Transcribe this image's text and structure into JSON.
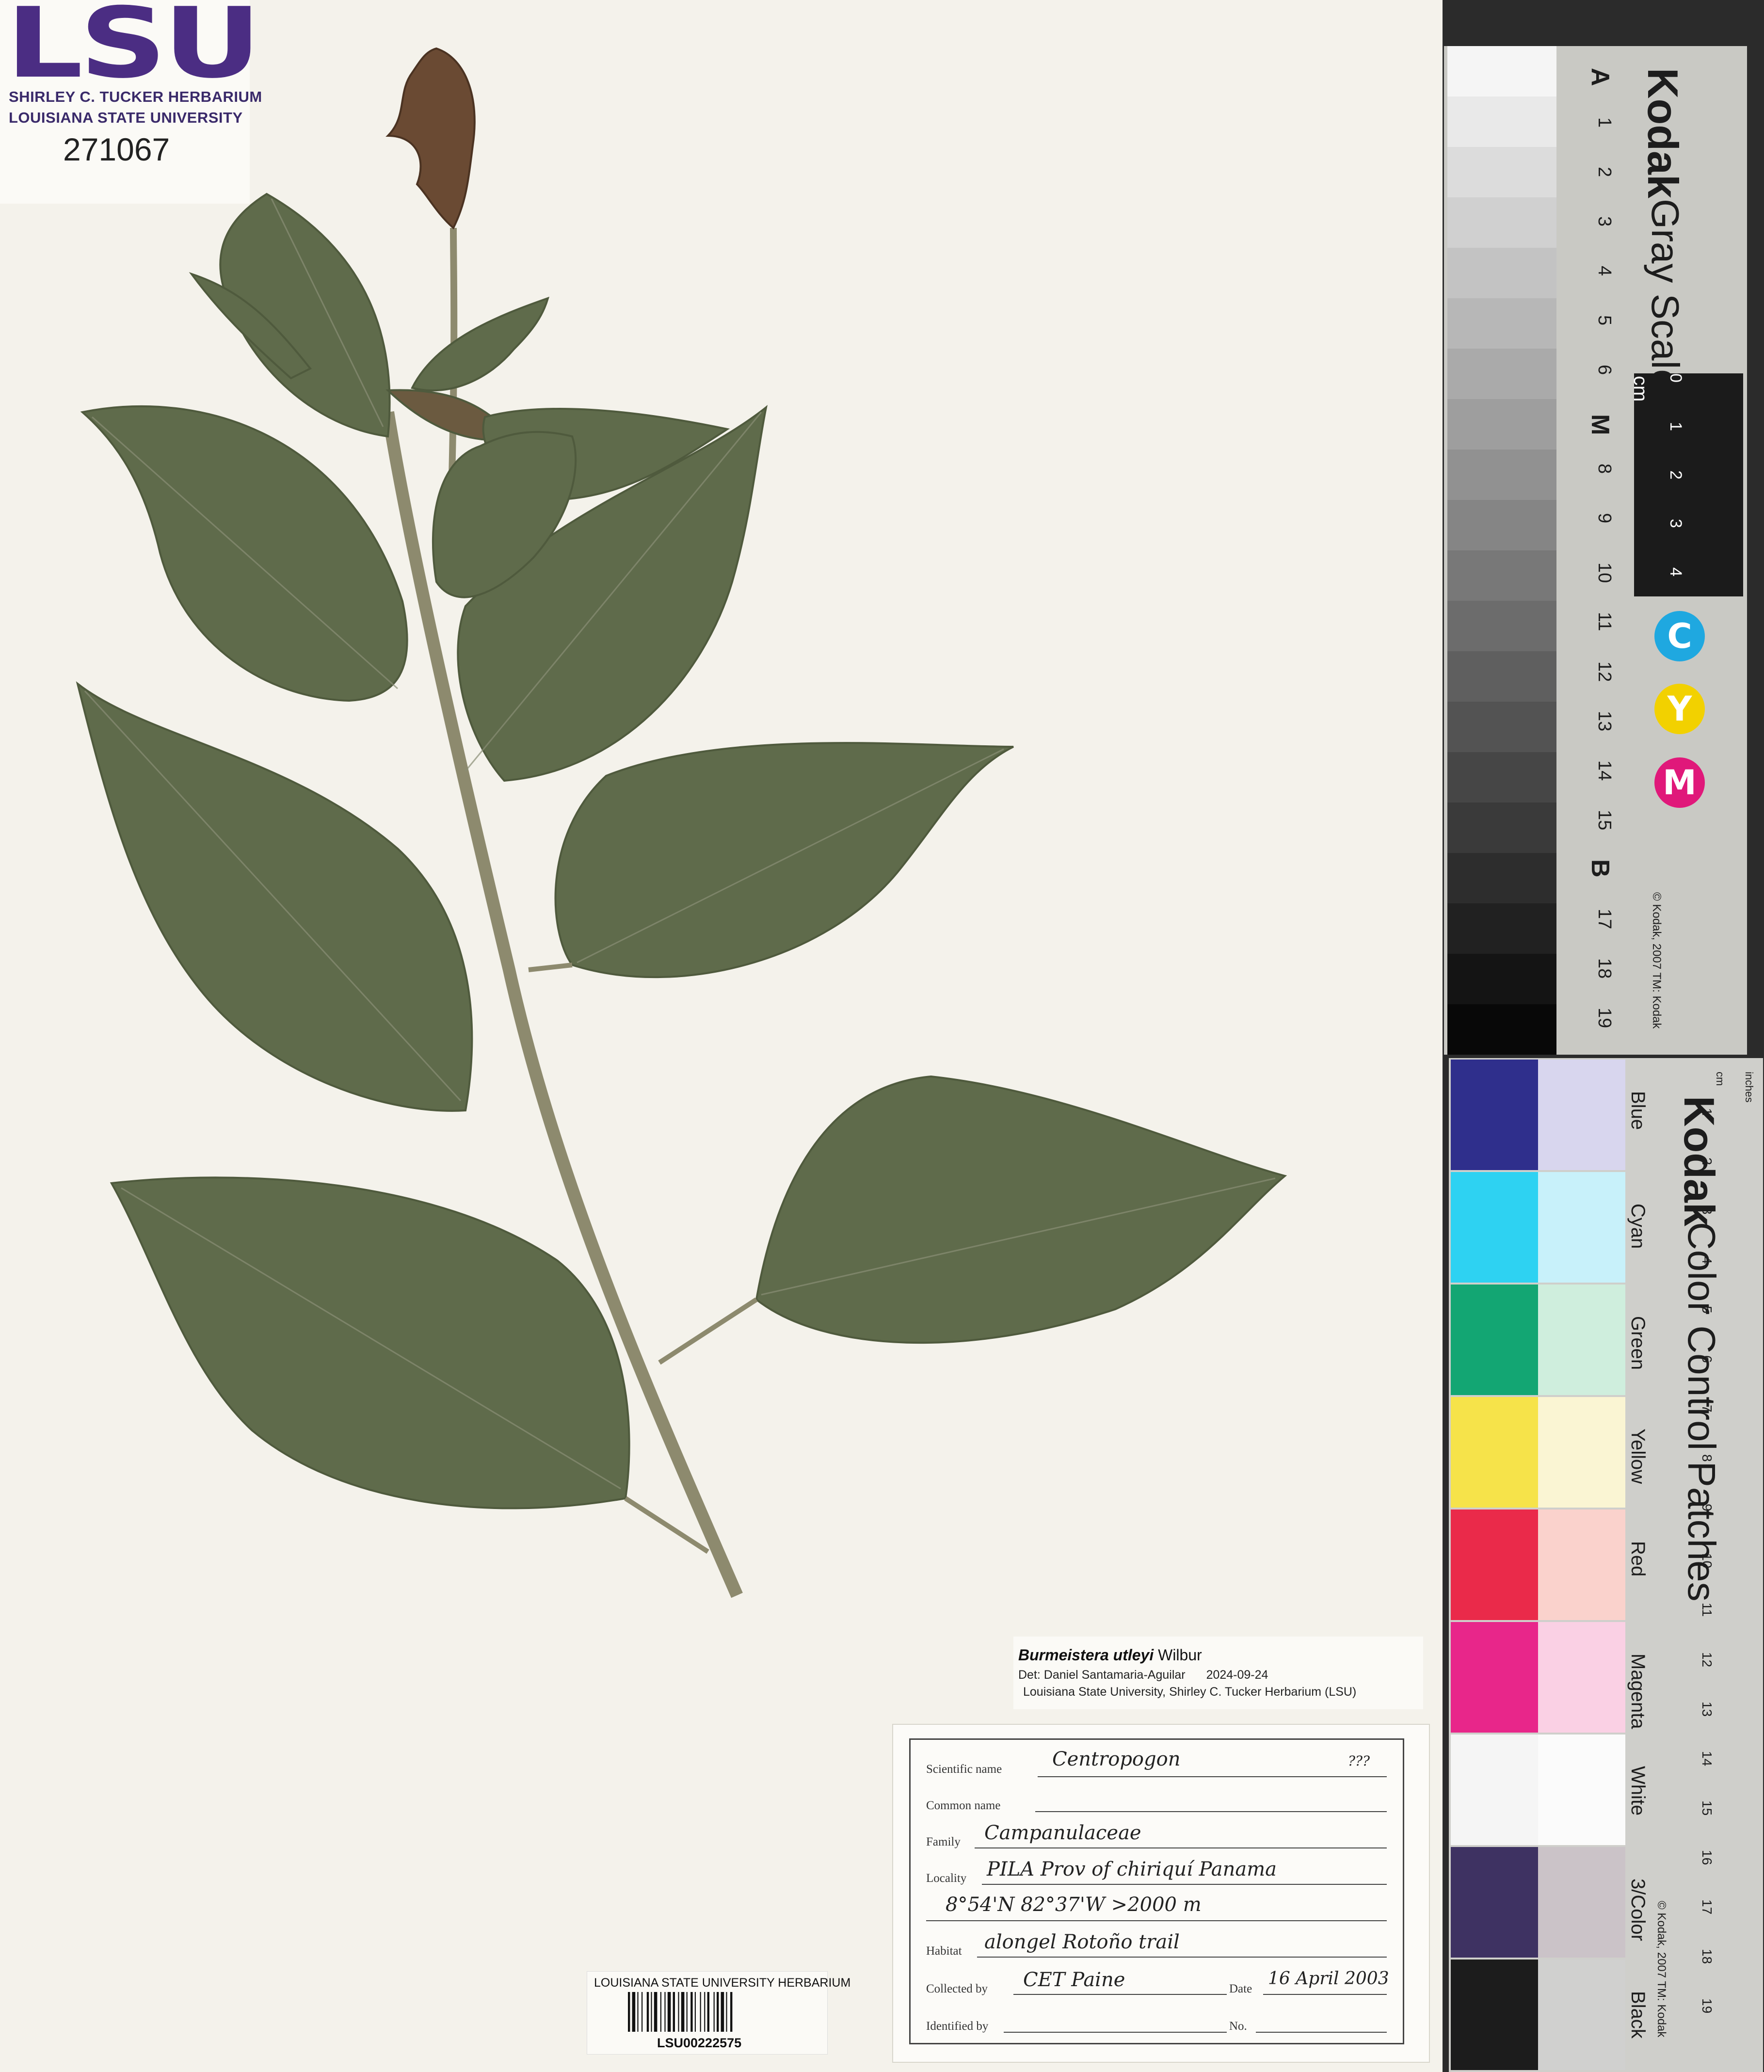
{
  "herbarium_logo": {
    "letters": "LSU",
    "line1": "SHIRLEY C. TUCKER HERBARIUM",
    "line2": "LOUISIANA STATE UNIVERSITY",
    "accession": "271067"
  },
  "gray_scale_card": {
    "brand": "Kodak",
    "title": "Gray Scale",
    "unit": "cm",
    "steps": [
      "A",
      "1",
      "2",
      "3",
      "4",
      "5",
      "6",
      "M",
      "8",
      "9",
      "10",
      "11",
      "12",
      "13",
      "14",
      "15",
      "B",
      "17",
      "18",
      "19"
    ],
    "ruler_ticks": [
      "0",
      "1",
      "2",
      "3",
      "4"
    ],
    "cmy": [
      "C",
      "Y",
      "M"
    ],
    "copyright": "© Kodak, 2007 TM: Kodak",
    "colors": {
      "cyan": "#1fa8e0",
      "yellow": "#f2d100",
      "magenta": "#e0187a"
    }
  },
  "color_card": {
    "brand": "Kodak",
    "title": "Color Control Patches",
    "patches": [
      "Blue",
      "Cyan",
      "Green",
      "Yellow",
      "Red",
      "Magenta",
      "White",
      "3/Color",
      "Black"
    ],
    "units": [
      "inches",
      "cm"
    ],
    "ruler_numbers": [
      "1",
      "2",
      "3",
      "4",
      "5",
      "6",
      "7",
      "8",
      "9",
      "10",
      "11",
      "12",
      "13",
      "14",
      "15",
      "16",
      "17",
      "18",
      "19"
    ],
    "copyright": "© Kodak, 2007 TM: Kodak",
    "colors": {
      "blue": "#2f2f8c",
      "cyan": "#2ed2f2",
      "green": "#13a673",
      "yellow": "#f6e34a",
      "red": "#ea2a4a",
      "magenta": "#e8268a",
      "white": "#f5f5f5",
      "three_color": "#3e3262",
      "black": "#1c1c1c"
    }
  },
  "determination_label": {
    "taxon": "Burmeistera utleyi",
    "author": "Wilbur",
    "det": "Det: Daniel Santamaria-Aguilar",
    "date": "2024-09-24",
    "institution": "Louisiana State University, Shirley C. Tucker Herbarium (LSU)"
  },
  "collection_label": {
    "scientific_name_label": "Scientific name",
    "scientific_name_value": "Centropogon",
    "scientific_name_note": "???",
    "common_name_label": "Common name",
    "family_label": "Family",
    "family_value": "Campanulaceae",
    "locality_label": "Locality",
    "locality_value": "PILA Prov of chiriquí Panama",
    "coordinates_value": "8°54'N 82°37'W >2000 m",
    "habitat_label": "Habitat",
    "habitat_value": "alongel Rotoño trail",
    "collected_by_label": "Collected by",
    "collected_by_value": "CET Paine",
    "date_label": "Date",
    "date_value": "16 April 2003",
    "identified_by_label": "Identified by",
    "no_label": "No."
  },
  "barcode_label": {
    "top": "LOUISIANA STATE UNIVERSITY HERBARIUM",
    "code": "LSU00222575"
  },
  "specimen": {
    "leaf_color": "#5f6b4b",
    "stem_color": "#8d8a6e",
    "flower_color": "#6a4a33"
  }
}
